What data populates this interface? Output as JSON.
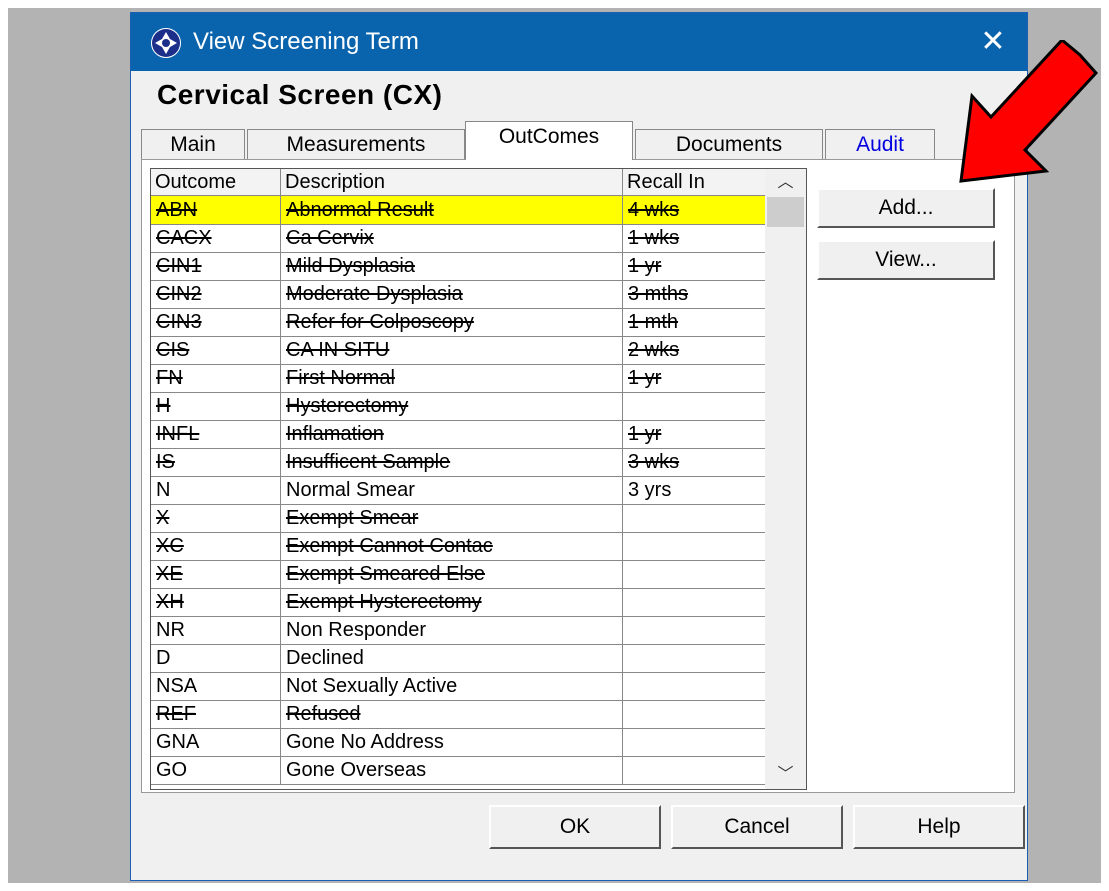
{
  "window": {
    "title": "View Screening Term",
    "close_glyph": "✕",
    "heading": "Cervical Screen (CX)"
  },
  "tabs": [
    {
      "label": "Main"
    },
    {
      "label": "Measurements"
    },
    {
      "label": "OutComes",
      "active": true
    },
    {
      "label": "Documents"
    },
    {
      "label": "Audit"
    }
  ],
  "table": {
    "columns": [
      "Outcome",
      "Description",
      "Recall In"
    ],
    "rows": [
      {
        "outcome": "ABN",
        "description": "Abnormal Result",
        "recall": "4 wks",
        "struck": true,
        "selected": true
      },
      {
        "outcome": "CACX",
        "description": "Ca Cervix",
        "recall": "1 wks",
        "struck": true
      },
      {
        "outcome": "CIN1",
        "description": "Mild Dysplasia",
        "recall": "1 yr",
        "struck": true
      },
      {
        "outcome": "CIN2",
        "description": "Moderate Dysplasia",
        "recall": "3 mths",
        "struck": true
      },
      {
        "outcome": "CIN3",
        "description": "Refer for Colposcopy",
        "recall": "1 mth",
        "struck": true
      },
      {
        "outcome": "CIS",
        "description": "CA IN SITU",
        "recall": "2 wks",
        "struck": true
      },
      {
        "outcome": "FN",
        "description": "First Normal",
        "recall": "1 yr",
        "struck": true
      },
      {
        "outcome": "H",
        "description": "Hysterectomy",
        "recall": "",
        "struck": true
      },
      {
        "outcome": "INFL",
        "description": "Inflamation",
        "recall": "1 yr",
        "struck": true
      },
      {
        "outcome": "IS",
        "description": "Insufficent Sample",
        "recall": "3 wks",
        "struck": true
      },
      {
        "outcome": "N",
        "description": "Normal Smear",
        "recall": "3 yrs",
        "struck": false
      },
      {
        "outcome": "X",
        "description": "Exempt Smear",
        "recall": "",
        "struck": true
      },
      {
        "outcome": "XC",
        "description": "Exempt Cannot Contac",
        "recall": "",
        "struck": true
      },
      {
        "outcome": "XE",
        "description": "Exempt  Smeared Else",
        "recall": "",
        "struck": true
      },
      {
        "outcome": "XH",
        "description": "Exempt Hysterectomy",
        "recall": "",
        "struck": true
      },
      {
        "outcome": "NR",
        "description": "Non Responder",
        "recall": "",
        "struck": false
      },
      {
        "outcome": "D",
        "description": "Declined",
        "recall": "",
        "struck": false
      },
      {
        "outcome": "NSA",
        "description": "Not Sexually Active",
        "recall": "",
        "struck": false
      },
      {
        "outcome": "REF",
        "description": "Refused",
        "recall": "",
        "struck": true
      },
      {
        "outcome": "GNA",
        "description": "Gone No Address",
        "recall": "",
        "struck": false
      },
      {
        "outcome": "GO",
        "description": "Gone Overseas",
        "recall": "",
        "struck": false
      }
    ]
  },
  "scrollbar": {
    "up_glyph": "︿",
    "down_glyph": "﹀"
  },
  "side_buttons": {
    "add": "Add...",
    "view": "View..."
  },
  "footer": {
    "ok": "OK",
    "cancel": "Cancel",
    "help": "Help"
  },
  "colors": {
    "titlebar": "#0a64ad",
    "selected_row": "#ffff00",
    "annotation_arrow": "#ff0000",
    "audit_tab": "#0000e0"
  }
}
